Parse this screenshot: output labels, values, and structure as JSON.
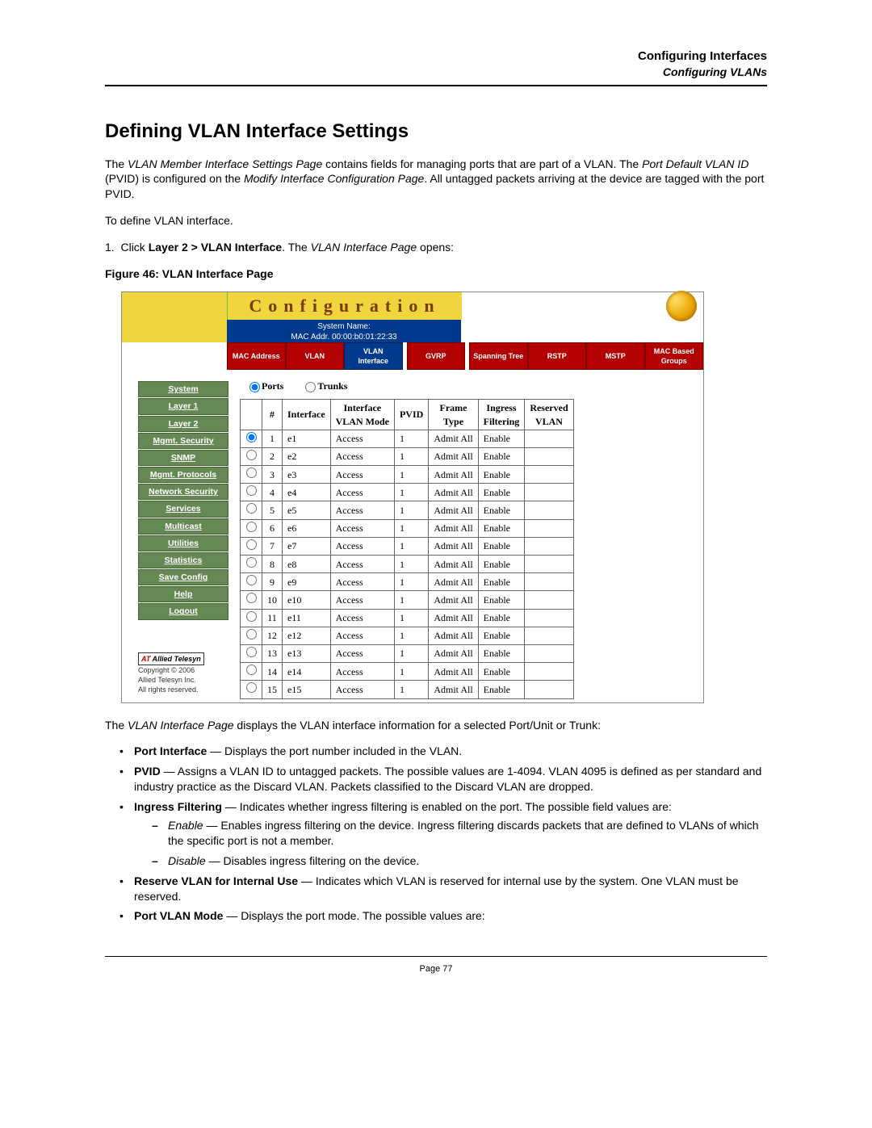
{
  "header": {
    "line1": "Configuring Interfaces",
    "line2": "Configuring VLANs"
  },
  "title": "Defining VLAN Interface Settings",
  "intro": {
    "p1a": "The ",
    "p1_italic1": "VLAN Member Interface Settings Page",
    "p1b": " contains fields for managing ports that are part of a VLAN. The ",
    "p1_italic2": "Port Default VLAN ID",
    "p1c": " (PVID) is configured on the ",
    "p1_italic3": "Modify Interface Configuration Page",
    "p1d": ". All untagged packets arriving at the device are tagged with the port PVID.",
    "p2": "To define VLAN interface.",
    "step1a": "Click ",
    "step1_bold": "Layer 2 > VLAN Interface",
    "step1b": ". The ",
    "step1_italic": "VLAN Interface Page",
    "step1c": " opens:"
  },
  "figure_caption": "Figure 46:  VLAN Interface Page",
  "screenshot": {
    "banner_title": "Configuration",
    "sysname_l1": "System Name:",
    "sysname_l2": "MAC Addr.  00:00:b0:01:22:33",
    "tabs": [
      "MAC Address",
      "VLAN",
      "VLAN Interface",
      "GVRP",
      "Spanning Tree",
      "RSTP",
      "MSTP",
      "MAC Based Groups"
    ],
    "selected_tab": 2,
    "sidebar": [
      "System",
      "Layer 1",
      "Layer 2",
      "Mgmt. Security",
      "SNMP",
      "Mgmt. Protocols",
      "Network Security",
      "Services",
      "Multicast",
      "Utilities",
      "Statistics",
      "Save Config",
      "Help",
      "Logout"
    ],
    "footer_brand_red": "AT",
    "footer_brand_rest": " Allied Telesyn",
    "footer_lines": [
      "Copyright © 2006",
      "Allied Telesyn Inc.",
      "All rights reserved."
    ],
    "radios": {
      "ports": "Ports",
      "trunks": "Trunks"
    },
    "columns": [
      "",
      "#",
      "Interface",
      "Interface VLAN Mode",
      "PVID",
      "Frame Type",
      "Ingress Filtering",
      "Reserved VLAN"
    ],
    "rows": [
      {
        "sel": true,
        "n": 1,
        "if": "e1",
        "mode": "Access",
        "pvid": "1",
        "ft": "Admit All",
        "ing": "Enable",
        "rv": ""
      },
      {
        "sel": false,
        "n": 2,
        "if": "e2",
        "mode": "Access",
        "pvid": "1",
        "ft": "Admit All",
        "ing": "Enable",
        "rv": ""
      },
      {
        "sel": false,
        "n": 3,
        "if": "e3",
        "mode": "Access",
        "pvid": "1",
        "ft": "Admit All",
        "ing": "Enable",
        "rv": ""
      },
      {
        "sel": false,
        "n": 4,
        "if": "e4",
        "mode": "Access",
        "pvid": "1",
        "ft": "Admit All",
        "ing": "Enable",
        "rv": ""
      },
      {
        "sel": false,
        "n": 5,
        "if": "e5",
        "mode": "Access",
        "pvid": "1",
        "ft": "Admit All",
        "ing": "Enable",
        "rv": ""
      },
      {
        "sel": false,
        "n": 6,
        "if": "e6",
        "mode": "Access",
        "pvid": "1",
        "ft": "Admit All",
        "ing": "Enable",
        "rv": ""
      },
      {
        "sel": false,
        "n": 7,
        "if": "e7",
        "mode": "Access",
        "pvid": "1",
        "ft": "Admit All",
        "ing": "Enable",
        "rv": ""
      },
      {
        "sel": false,
        "n": 8,
        "if": "e8",
        "mode": "Access",
        "pvid": "1",
        "ft": "Admit All",
        "ing": "Enable",
        "rv": ""
      },
      {
        "sel": false,
        "n": 9,
        "if": "e9",
        "mode": "Access",
        "pvid": "1",
        "ft": "Admit All",
        "ing": "Enable",
        "rv": ""
      },
      {
        "sel": false,
        "n": 10,
        "if": "e10",
        "mode": "Access",
        "pvid": "1",
        "ft": "Admit All",
        "ing": "Enable",
        "rv": ""
      },
      {
        "sel": false,
        "n": 11,
        "if": "e11",
        "mode": "Access",
        "pvid": "1",
        "ft": "Admit All",
        "ing": "Enable",
        "rv": ""
      },
      {
        "sel": false,
        "n": 12,
        "if": "e12",
        "mode": "Access",
        "pvid": "1",
        "ft": "Admit All",
        "ing": "Enable",
        "rv": ""
      },
      {
        "sel": false,
        "n": 13,
        "if": "e13",
        "mode": "Access",
        "pvid": "1",
        "ft": "Admit All",
        "ing": "Enable",
        "rv": ""
      },
      {
        "sel": false,
        "n": 14,
        "if": "e14",
        "mode": "Access",
        "pvid": "1",
        "ft": "Admit All",
        "ing": "Enable",
        "rv": ""
      },
      {
        "sel": false,
        "n": 15,
        "if": "e15",
        "mode": "Access",
        "pvid": "1",
        "ft": "Admit All",
        "ing": "Enable",
        "rv": ""
      }
    ]
  },
  "after": {
    "p3a": "The ",
    "p3_italic": "VLAN Interface Page",
    "p3b": " displays the VLAN interface information for a selected Port/Unit or Trunk:",
    "b1_bold": "Port Interface",
    "b1_rest": " — Displays the port number included in the VLAN.",
    "b2_bold": "PVID",
    "b2_rest": " — Assigns a VLAN ID to untagged packets. The possible values are 1-4094. VLAN 4095 is defined as per standard and industry practice as the Discard VLAN. Packets classified to the Discard VLAN are dropped.",
    "b3_bold": "Ingress Filtering",
    "b3_rest": " — Indicates whether ingress filtering is enabled on the port. The possible field values are:",
    "b3s1_it": "Enable",
    "b3s1_rest": " — Enables ingress filtering on the device. Ingress filtering discards packets that are defined to VLANs of which the specific port is not a member.",
    "b3s2_it": "Disable",
    "b3s2_rest": " — Disables ingress filtering on the device.",
    "b4_bold": "Reserve VLAN for Internal Use",
    "b4_rest": " — Indicates which VLAN is reserved for internal use by the system. One VLAN must be reserved.",
    "b5_bold": "Port VLAN Mode",
    "b5_rest": " — Displays the port mode. The possible values are:"
  },
  "page_number": "Page 77"
}
